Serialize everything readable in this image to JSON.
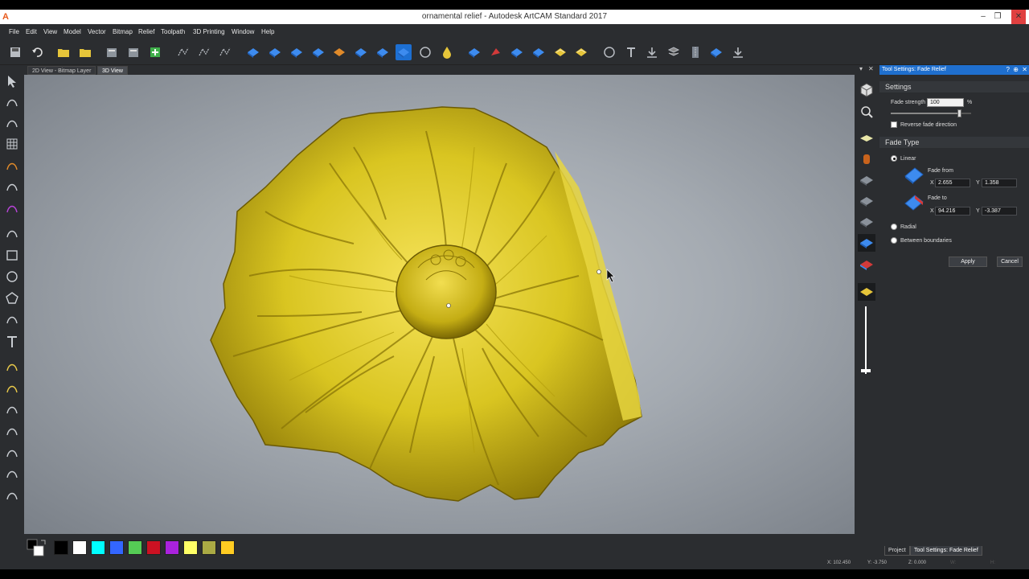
{
  "window": {
    "title": "ornamental relief - Autodesk ArtCAM Standard 2017",
    "app_icon": "A",
    "minimize": "–",
    "maximize": "❐",
    "close": "✕"
  },
  "menu": [
    "File",
    "Edit",
    "View",
    "Model",
    "Vector",
    "Bitmap",
    "Relief",
    "Toolpath",
    "3D Printing",
    "Window",
    "Help"
  ],
  "view_tabs": [
    {
      "label": "2D View - Bitmap Layer",
      "active": false
    },
    {
      "label": "3D View",
      "active": true
    }
  ],
  "toolbar_icons": [
    "save-icon",
    "undo-icon",
    "open-folder-icon",
    "open-model-icon",
    "import-model-icon",
    "layers-icon",
    "add-relief-icon",
    "node-icon",
    "wave-icon",
    "polyline-icon",
    "relief-blue-icon",
    "relief-add-icon",
    "relief-subtract-icon",
    "relief-tilt-icon",
    "relief-orange-icon",
    "relief-layer-icon",
    "relief-scale-icon",
    "fade-relief-icon",
    "smooth-icon",
    "drop-icon",
    "shape-blue-icon",
    "eraser-icon",
    "relief-shape-icon",
    "relief-flat-icon",
    "texture-icon",
    "yellow-layer-icon",
    "wrap-icon",
    "text-icon",
    "download-icon",
    "stack-icon",
    "zip-icon",
    "relief-arrow-icon",
    "export-icon"
  ],
  "left_tool_icons": [
    "select-icon",
    "node-edit-icon",
    "transform-icon",
    "grid-icon",
    "lasso-icon",
    "brush-icon",
    "crop-icon",
    "pen-icon",
    "rectangle-icon",
    "ellipse-icon",
    "polygon-icon",
    "arc-icon",
    "text-tool-icon",
    "vector-tool-icon",
    "magic-icon",
    "curve-icon",
    "offset-icon",
    "join-icon",
    "bound-icon",
    "fill-icon"
  ],
  "right_strip_icons": [
    "view-cube-icon",
    "zoom-icon",
    "flat-plane-icon",
    "cylinder-icon",
    "relief-shaded-icon",
    "relief-sculpt-icon",
    "relief-wireframe-icon",
    "fade-relief-active-icon",
    "relief-color-icon",
    "yellow-relief-icon"
  ],
  "palette": {
    "colors": [
      "#000000",
      "#ffffff",
      "#00ffff",
      "#3366ff",
      "#55cc55",
      "#cc1122",
      "#aa22dd",
      "#ffff66",
      "#aaaa44",
      "#ffcc22"
    ]
  },
  "relief_color": "#d9c521",
  "tool_panel": {
    "title": "Tool Settings: Fade Relief",
    "help": "?",
    "pin": "⊕",
    "close": "✕",
    "settings_section": "Settings",
    "fade_strength_label": "Fade strength",
    "fade_strength_value": "100",
    "fade_strength_unit": "%",
    "fade_strength_slider": 0.85,
    "reverse_label": "Reverse fade direction",
    "fade_type_section": "Fade Type",
    "linear_label": "Linear",
    "fade_from_label": "Fade from",
    "fade_from_x_label": "X",
    "fade_from_x": "2.655",
    "fade_from_y_label": "Y",
    "fade_from_y": "1.358",
    "fade_to_label": "Fade to",
    "fade_to_x_label": "X",
    "fade_to_x": "94.216",
    "fade_to_y_label": "Y",
    "fade_to_y": "-3.387",
    "radial_label": "Radial",
    "between_label": "Between boundaries",
    "apply_label": "Apply",
    "cancel_label": "Cancel"
  },
  "bottom_tabs": [
    "Project",
    "Tool Settings: Fade Relief"
  ],
  "status": {
    "x": "X: 102.450",
    "y": "Y: -3.750",
    "z": "Z: 0.000",
    "w": "W:",
    "h": "H:"
  }
}
